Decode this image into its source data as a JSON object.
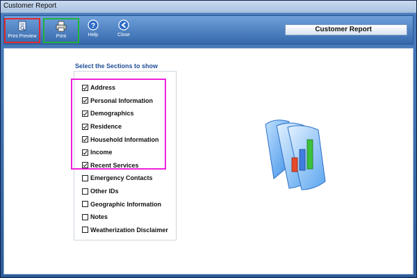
{
  "window": {
    "title": "Customer Report"
  },
  "toolbar": {
    "buttons": [
      {
        "label": "Print Preview",
        "icon": "print-preview-icon"
      },
      {
        "label": "Print",
        "icon": "printer-icon"
      },
      {
        "label": "Help",
        "icon": "help-icon"
      },
      {
        "label": "Close",
        "icon": "back-arrow-icon"
      }
    ],
    "report_label": "Customer Report",
    "highlight_colors": {
      "print_preview": "#e4282d",
      "print": "#1eb43b"
    }
  },
  "sections": {
    "heading": "Select the Sections to show",
    "highlight_color": "#ee1fdc",
    "items": [
      {
        "label": "Address",
        "checked": true
      },
      {
        "label": "Personal Information",
        "checked": true
      },
      {
        "label": "Demographics",
        "checked": true
      },
      {
        "label": "Residence",
        "checked": true
      },
      {
        "label": "Household Information",
        "checked": true
      },
      {
        "label": "Income",
        "checked": true
      },
      {
        "label": "Recent Services",
        "checked": true
      },
      {
        "label": "Emergency Contacts",
        "checked": false
      },
      {
        "label": "Other IDs",
        "checked": false
      },
      {
        "label": "Geographic Information",
        "checked": false
      },
      {
        "label": "Notes",
        "checked": false
      },
      {
        "label": "Weatherization Disclaimer",
        "checked": false
      }
    ]
  },
  "illustration": {
    "icon": "report-chart-icon"
  }
}
